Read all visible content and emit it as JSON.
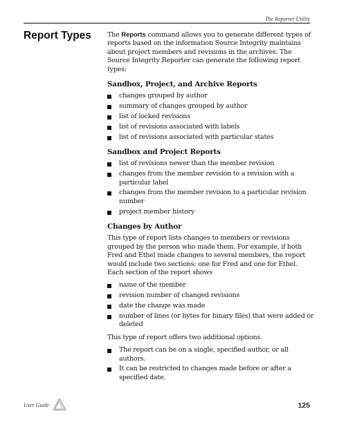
{
  "header": {
    "running_title": "The Reporter Utility"
  },
  "section": {
    "title": "Report Types",
    "intro": {
      "before": "The ",
      "command": "Reports",
      "after": " command allows you to generate different types of reports based on the information Source Integrity maintains about project members and revisions in the archives. The Source Integrity Reporter can generate the following report types:"
    },
    "groups": [
      {
        "heading": "Sandbox, Project, and Archive Reports",
        "items": [
          "changes grouped by author",
          "summary of changes grouped by author",
          "list of locked revisions",
          "list of revisions associated with labels",
          "list of revisions associated with particular states"
        ]
      },
      {
        "heading": "Sandbox and Project Reports",
        "items": [
          "list of revisions newer than the member revision",
          "changes from the member revision to a revision with a particular label",
          "changes from the member revision to a particular revision number",
          "project member history"
        ]
      }
    ],
    "changes_by_author": {
      "heading": "Changes by Author",
      "paragraph": "This type of report lists changes to members or revisions grouped by the person who made them. For example, if both Fred and Ethel made changes to several members, the report would include two sections; one for Fred and one for Ethel. Each section of the report shows",
      "items": [
        "name of the member",
        "revision number of changed revisions",
        "date the change was made",
        "number of lines (or bytes for binary files) that were added or deleted"
      ],
      "options_intro": "This type of report offers two additional options.",
      "options": [
        "The report can be on a single, specified author, or all authors.",
        "It can be restricted to changes made before or after a specified date."
      ]
    }
  },
  "footer": {
    "guide_label": "User Guide",
    "logo_icon": "triangle-logo-icon",
    "page_number": "125"
  }
}
